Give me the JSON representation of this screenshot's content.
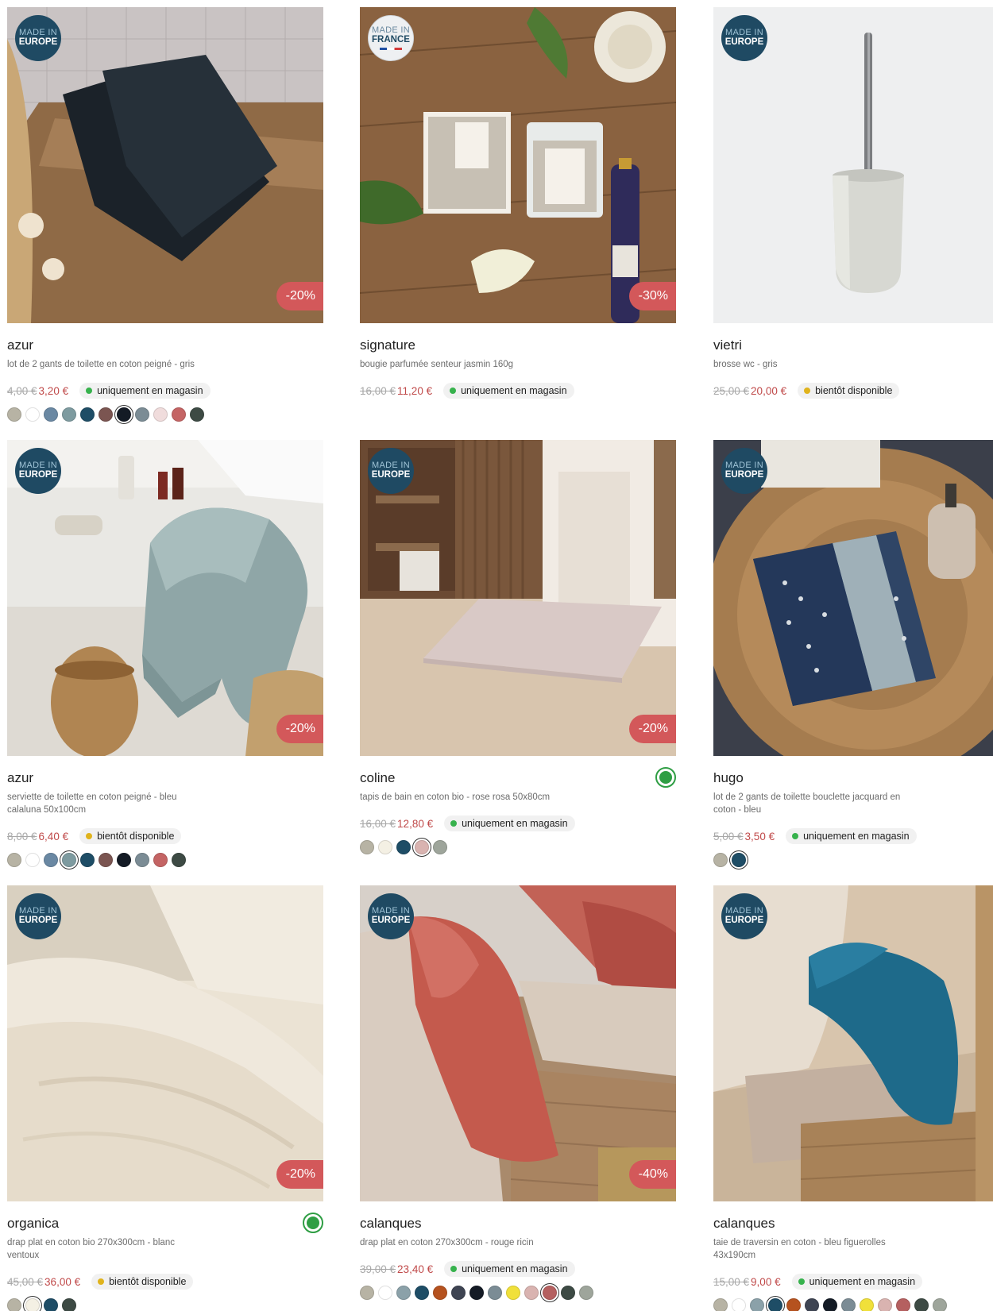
{
  "products": [
    {
      "origin": [
        "MADE IN",
        "EUROPE"
      ],
      "discount": "-20%",
      "name": "azur",
      "desc": "lot de 2 gants de toilette en coton peigné - gris",
      "old_price": "4,00 €",
      "price": "3,20 €",
      "availability": "uniquement en magasin",
      "availability_color": "green",
      "swatches": [
        "#b7b3a4",
        "#ffffff",
        "#6a88a3",
        "#7e9ba0",
        "#1e4d66",
        "#7b5551",
        "#141b25",
        "#7b8c95",
        "#f0dcdc",
        "#c46464",
        "#3d4a44"
      ],
      "selected_swatch": 6,
      "image": "dark-towel"
    },
    {
      "origin": [
        "MADE IN",
        "FRANCE"
      ],
      "discount": "-30%",
      "name": "signature",
      "desc": "bougie parfumée senteur jasmin 160g",
      "old_price": "16,00 €",
      "price": "11,20 €",
      "availability": "uniquement en magasin",
      "availability_color": "green",
      "swatches": [],
      "selected_swatch": -1,
      "image": "candle"
    },
    {
      "origin": [
        "MADE IN",
        "EUROPE"
      ],
      "discount": "",
      "name": "vietri",
      "desc": "brosse wc - gris",
      "old_price": "25,00 €",
      "price": "20,00 €",
      "availability": "bientôt disponible",
      "availability_color": "yellow",
      "swatches": [],
      "selected_swatch": -1,
      "image": "brush"
    },
    {
      "origin": [
        "MADE IN",
        "EUROPE"
      ],
      "discount": "-20%",
      "name": "azur",
      "desc": "serviette de toilette en coton peigné - bleu calaluna 50x100cm",
      "old_price": "8,00 €",
      "price": "6,40 €",
      "availability": "bientôt disponible",
      "availability_color": "yellow",
      "swatches": [
        "#b7b3a4",
        "#ffffff",
        "#6a88a3",
        "#7e9ba0",
        "#1e4d66",
        "#7b5551",
        "#141b25",
        "#7b8c95",
        "#c46464",
        "#3d4a44"
      ],
      "selected_swatch": 3,
      "image": "blue-towel"
    },
    {
      "origin": [
        "MADE IN",
        "EUROPE"
      ],
      "discount": "-20%",
      "name": "coline",
      "desc": "tapis de bain en coton bio - rose rosa 50x80cm",
      "old_price": "16,00 €",
      "price": "12,80 €",
      "availability": "uniquement en magasin",
      "availability_color": "green",
      "swatches": [
        "#b7b3a4",
        "#f4f0e4",
        "#1e4d66",
        "#d9b3b0",
        "#9ea59b"
      ],
      "selected_swatch": 3,
      "image": "bath-mat",
      "eco": true
    },
    {
      "origin": [
        "MADE IN",
        "EUROPE"
      ],
      "discount": "",
      "name": "hugo",
      "desc": "lot de 2 gants de toilette bouclette jacquard en coton - bleu",
      "old_price": "5,00 €",
      "price": "3,50 €",
      "availability": "uniquement en magasin",
      "availability_color": "green",
      "swatches": [
        "#b7b3a4",
        "#1e4d66"
      ],
      "selected_swatch": 1,
      "image": "jacquard"
    },
    {
      "origin": [
        "MADE IN",
        "EUROPE"
      ],
      "discount": "-20%",
      "name": "organica",
      "desc": "drap plat en coton bio 270x300cm - blanc ventoux",
      "old_price": "45,00 €",
      "price": "36,00 €",
      "availability": "bientôt disponible",
      "availability_color": "yellow",
      "swatches": [
        "#b7b3a4",
        "#f4f0e4",
        "#1e4d66",
        "#3d4a44"
      ],
      "selected_swatch": 1,
      "image": "white-sheet",
      "eco": true
    },
    {
      "origin": [
        "MADE IN",
        "EUROPE"
      ],
      "discount": "-40%",
      "name": "calanques",
      "desc": "drap plat en coton 270x300cm - rouge ricin",
      "old_price": "39,00 €",
      "price": "23,40 €",
      "availability": "uniquement en magasin",
      "availability_color": "green",
      "swatches": [
        "#b7b3a4",
        "#ffffff",
        "#8ba1a9",
        "#1e4d66",
        "#b5521f",
        "#3e4452",
        "#141b25",
        "#7b8c95",
        "#f0e03a",
        "#d9b3b0",
        "#b56060",
        "#3d4a44",
        "#9ea59b"
      ],
      "selected_swatch": 10,
      "image": "red-sheet"
    },
    {
      "origin": [
        "MADE IN",
        "EUROPE"
      ],
      "discount": "",
      "name": "calanques",
      "desc": "taie de traversin en coton - bleu figuerolles 43x190cm",
      "old_price": "15,00 €",
      "price": "9,00 €",
      "availability": "uniquement en magasin",
      "availability_color": "green",
      "swatches": [
        "#b7b3a4",
        "#ffffff",
        "#8ba1a9",
        "#1e4d66",
        "#b5521f",
        "#3e4452",
        "#141b25",
        "#7b8c95",
        "#f0e03a",
        "#d9b3b0",
        "#b56060",
        "#3d4a44",
        "#9ea59b"
      ],
      "selected_swatch": 3,
      "image": "blue-pillow"
    }
  ]
}
